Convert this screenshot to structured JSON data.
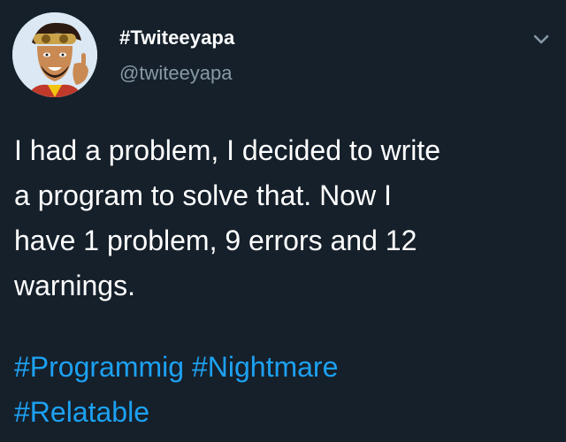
{
  "user": {
    "display_name": "#Twiteeyapa",
    "handle": "@twiteeyapa"
  },
  "tweet": {
    "text_lines": [
      "I had a problem, I decided to write",
      "a program to solve that. Now I",
      "have 1 problem, 9 errors and 12",
      "warnings."
    ],
    "hashtags": [
      "#Programmig",
      "#Nightmare",
      "#Relatable"
    ]
  },
  "icons": {
    "menu": "chevron-down-icon",
    "avatar": "cartoon-avatar"
  },
  "colors": {
    "background": "#15202b",
    "text": "#ffffff",
    "handle": "#8899a6",
    "link": "#1da1f2"
  }
}
